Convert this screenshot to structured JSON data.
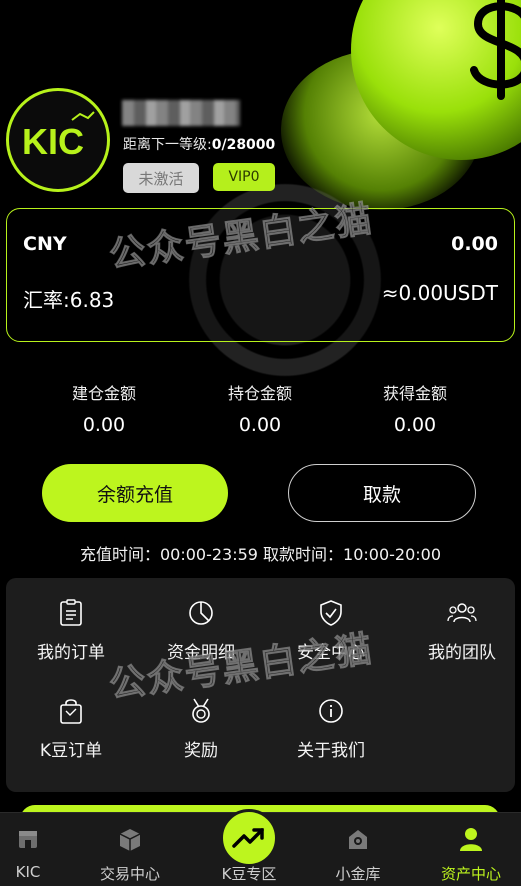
{
  "header": {
    "logo_text": "KIC",
    "level_label": "距离下一等级:",
    "level_value": "0/28000",
    "status_badge": "未激活",
    "vip_badge": "VIP0"
  },
  "balance_card": {
    "currency": "CNY",
    "balance": "0.00",
    "rate": "汇率:6.83",
    "usdt": "≈0.00USDT"
  },
  "stats": [
    {
      "label": "建仓金额",
      "value": "0.00"
    },
    {
      "label": "持仓金额",
      "value": "0.00"
    },
    {
      "label": "获得金额",
      "value": "0.00"
    }
  ],
  "actions": {
    "recharge": "余额充值",
    "withdraw": "取款"
  },
  "hours_text": "充值时间：00:00-23:59   取款时间：10:00-20:00",
  "menu": [
    {
      "label": "我的订单",
      "icon": "order-list-icon"
    },
    {
      "label": "资金明细",
      "icon": "pie-chart-icon"
    },
    {
      "label": "安全中心",
      "icon": "shield-check-icon"
    },
    {
      "label": "我的团队",
      "icon": "team-icon"
    },
    {
      "label": "K豆订单",
      "icon": "shopping-bag-icon"
    },
    {
      "label": "奖励",
      "icon": "medal-icon"
    },
    {
      "label": "关于我们",
      "icon": "info-icon"
    }
  ],
  "nav": [
    {
      "label": "KIC",
      "icon": "home-icon"
    },
    {
      "label": "交易中心",
      "icon": "cube-icon"
    },
    {
      "label": "K豆专区",
      "icon": "trend-icon"
    },
    {
      "label": "小金库",
      "icon": "vault-icon"
    },
    {
      "label": "资产中心",
      "icon": "user-icon"
    }
  ],
  "watermark": "公众号黑白之猫",
  "colors": {
    "accent": "#bdf51e",
    "panel": "#1d1d1d",
    "background": "#000000"
  }
}
